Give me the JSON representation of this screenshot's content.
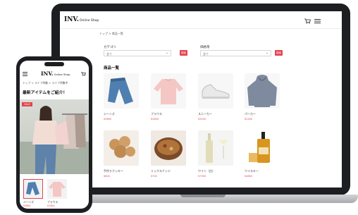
{
  "laptop": {
    "logo": "INV.",
    "logo_sub": "Online Shop",
    "breadcrumb": "トップ > 商品一覧",
    "filters": [
      {
        "label": "カテゴリ",
        "value": "全て",
        "button": "検索"
      },
      {
        "label": "価格帯",
        "value": "全て",
        "button": "検索"
      }
    ],
    "section_title": "商品一覧",
    "products": [
      {
        "name": "ジーンズ",
        "price": "¥3800"
      },
      {
        "name": "ブラウス",
        "price": "¥2800"
      },
      {
        "name": "スニーカー",
        "price": "¥3200"
      },
      {
        "name": "パーカー",
        "price": "¥2400"
      },
      {
        "name": "手作りクッキー",
        "price": "¥800"
      },
      {
        "name": "ミックスナッツ",
        "price": "¥700"
      },
      {
        "name": "ワイン（白）",
        "price": "¥7300"
      },
      {
        "name": "ウイスキー",
        "price": "¥4800"
      }
    ],
    "colors": {
      "accent": "#e0464e",
      "bezel": "#1d1e21"
    }
  },
  "phone": {
    "logo": "INV.",
    "logo_sub": "Online Shop",
    "breadcrumb": "トップ > ライフ特集 > ライフ特集中",
    "headline": "最新アイテムをご紹介！",
    "badge": "SALE",
    "mini_products": [
      {
        "name": "ジーンズ",
        "price": "¥3800"
      },
      {
        "name": "ブラウス",
        "price": "¥1900"
      }
    ]
  }
}
